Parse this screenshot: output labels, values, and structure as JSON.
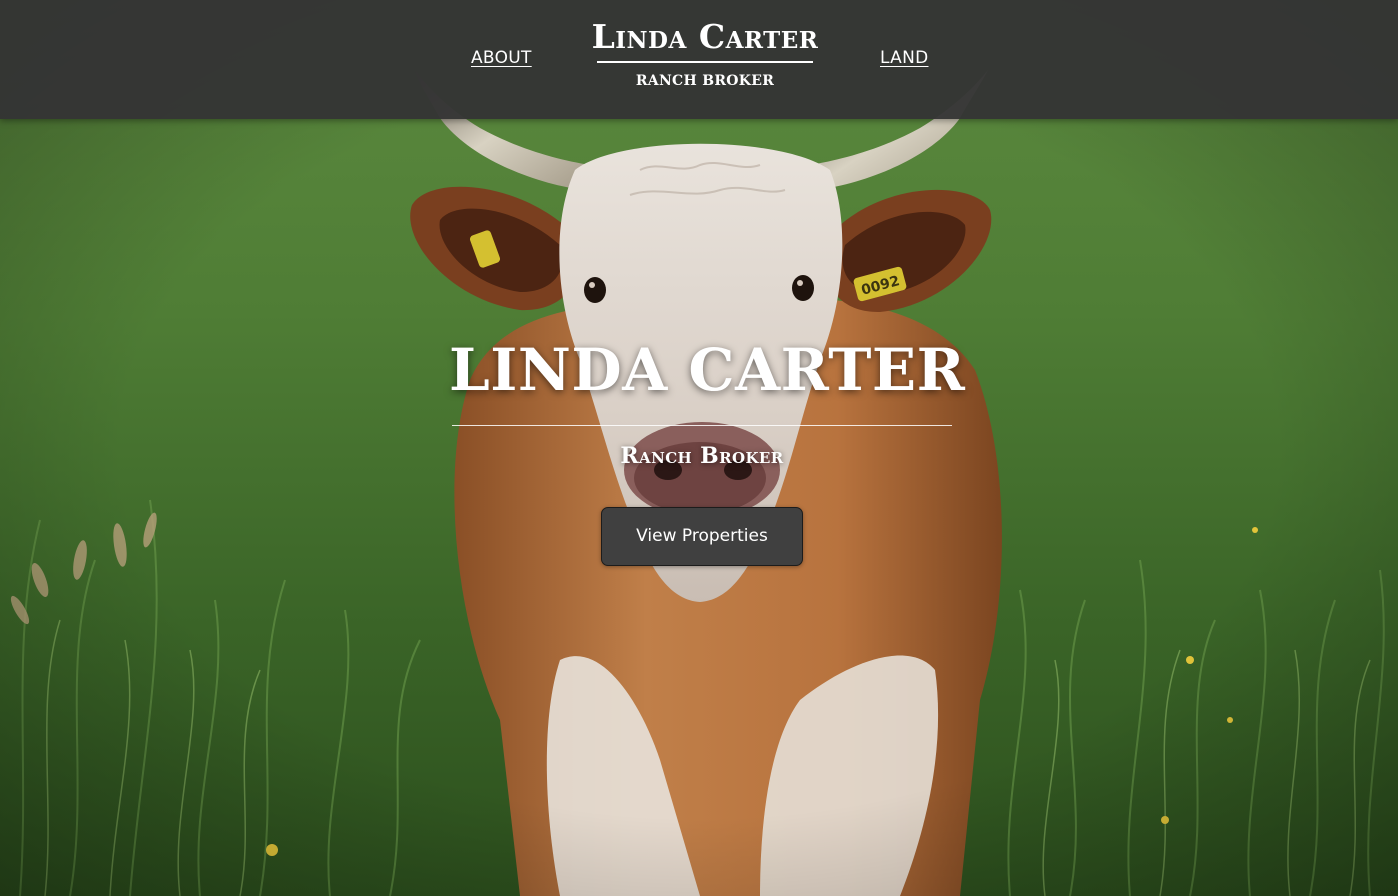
{
  "nav": {
    "about_label": "ABOUT",
    "land_label": "LAND"
  },
  "brand": {
    "name": "Linda Carter",
    "tagline": "Ranch Broker"
  },
  "hero": {
    "title": "LINDA CARTER",
    "subtitle": "Ranch Broker",
    "cta_label": "View Properties",
    "ear_tag_text": "0092"
  },
  "colors": {
    "topbar_bg": "#343434",
    "button_bg": "#404040",
    "text": "#ffffff",
    "grass": "#3f6b2a",
    "cow_coat": "#b5723f"
  },
  "icons": {
    "background": "cow-in-pasture-photo"
  }
}
